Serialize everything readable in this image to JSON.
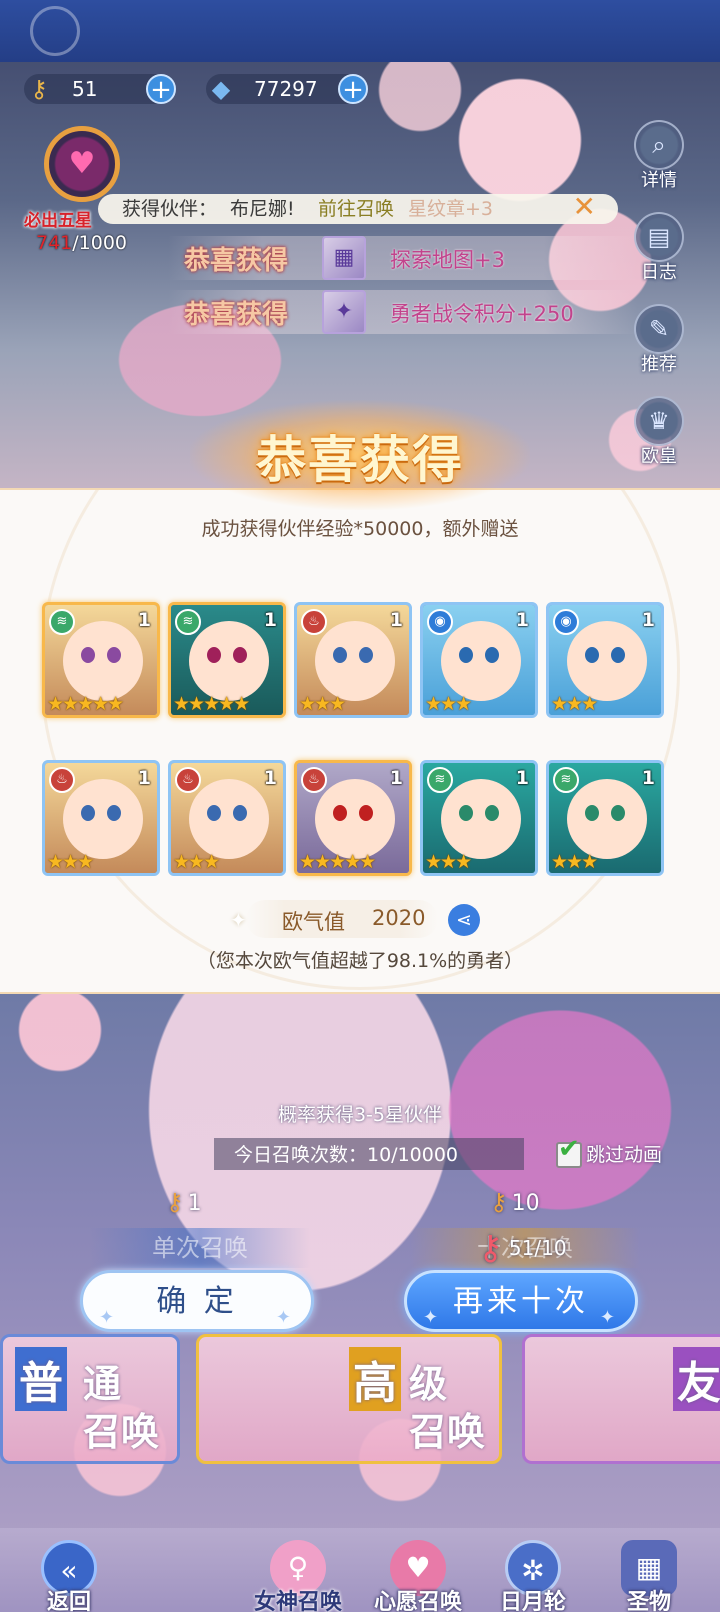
{
  "resources": {
    "keys": "51",
    "crystals": "77297"
  },
  "pity": {
    "label": "必出五星",
    "current": "741",
    "total": "/1000"
  },
  "side_buttons": [
    {
      "label": "详情",
      "icon": "magnifier-icon"
    },
    {
      "label": "日志",
      "icon": "book-icon"
    },
    {
      "label": "推荐",
      "icon": "feather-icon"
    },
    {
      "label": "欧皇",
      "icon": "crown-icon"
    }
  ],
  "notification": {
    "prefix": "获得伙伴：",
    "partner": "布尼娜!",
    "link": "前往召唤",
    "faded": "星纹章+3"
  },
  "grants": [
    {
      "title": "恭喜获得",
      "desc": "探索地图+3"
    },
    {
      "title": "恭喜获得",
      "desc": "勇者战令积分+250"
    }
  ],
  "result": {
    "title": "恭喜获得",
    "subtitle": "成功获得伙伴经验*50000，额外赠送",
    "cards": [
      {
        "element": "wind",
        "level": "1",
        "stars": 5,
        "rarity": 5
      },
      {
        "element": "wind",
        "level": "1",
        "stars": 5,
        "rarity": 5
      },
      {
        "element": "fire",
        "level": "1",
        "stars": 3,
        "rarity": 3
      },
      {
        "element": "water",
        "level": "1",
        "stars": 3,
        "rarity": 3
      },
      {
        "element": "water",
        "level": "1",
        "stars": 3,
        "rarity": 3
      },
      {
        "element": "fire",
        "level": "1",
        "stars": 3,
        "rarity": 3
      },
      {
        "element": "fire",
        "level": "1",
        "stars": 3,
        "rarity": 3
      },
      {
        "element": "fire",
        "level": "1",
        "stars": 5,
        "rarity": 5
      },
      {
        "element": "wind",
        "level": "1",
        "stars": 3,
        "rarity": 3
      },
      {
        "element": "wind",
        "level": "1",
        "stars": 3,
        "rarity": 3
      }
    ],
    "luck_label": "欧气值",
    "luck_value": "2020",
    "luck_note": "（您本次欧气值超越了98.1%的勇者）"
  },
  "summon": {
    "probability": "概率获得3-5星伙伴",
    "today": "今日召唤次数：10/10000",
    "skip_label": "跳过动画",
    "skip_checked": true,
    "single_cost": "1",
    "ten_cost": "10",
    "single_label": "单次召唤",
    "ten_label": "十次召唤",
    "tickets": "51/10",
    "confirm_label": "确 定",
    "again_label": "再来十次"
  },
  "banners": [
    {
      "big": "普",
      "rest1": "通",
      "rest2": "召唤"
    },
    {
      "big": "高",
      "rest1": "级",
      "rest2": "召唤"
    },
    {
      "big": "友",
      "rest1": "",
      "rest2": ""
    }
  ],
  "nav": [
    {
      "label": "返回",
      "icon": "back-arrow-icon"
    },
    {
      "label": "女神召唤",
      "icon": "goddess-icon"
    },
    {
      "label": "心愿召唤",
      "icon": "heart-icon"
    },
    {
      "label": "日月轮",
      "icon": "compass-icon"
    },
    {
      "label": "圣物",
      "icon": "relic-icon"
    }
  ],
  "colors": {
    "accent_blue": "#2f78e8",
    "pity_red": "#e0242a",
    "star_gold": "#f8b820"
  }
}
